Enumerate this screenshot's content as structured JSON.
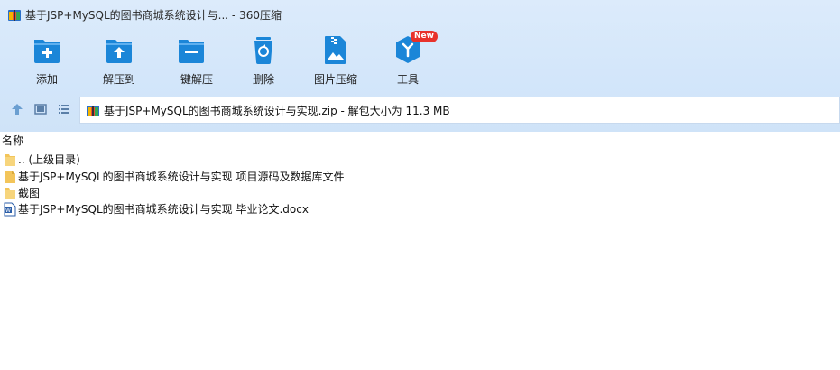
{
  "window": {
    "title": "基于JSP+MySQL的图书商城系统设计与... - 360压缩",
    "icon": "archive-icon"
  },
  "toolbar": {
    "items": [
      {
        "label": "添加",
        "icon": "add-folder-icon"
      },
      {
        "label": "解压到",
        "icon": "extract-to-icon"
      },
      {
        "label": "一键解压",
        "icon": "one-click-extract-icon"
      },
      {
        "label": "删除",
        "icon": "delete-icon"
      },
      {
        "label": "图片压缩",
        "icon": "image-compress-icon"
      },
      {
        "label": "工具",
        "icon": "tools-icon",
        "badge": "New"
      }
    ]
  },
  "address": {
    "path": "基于JSP+MySQL的图书商城系统设计与实现.zip - 解包大小为 11.3 MB"
  },
  "list": {
    "column_name": "名称",
    "items": [
      {
        "name": ".. (上级目录)",
        "icon": "folder-icon"
      },
      {
        "name": "基于JSP+MySQL的图书商城系统设计与实现 项目源码及数据库文件",
        "icon": "file-icon"
      },
      {
        "name": "截图",
        "icon": "folder-icon"
      },
      {
        "name": "基于JSP+MySQL的图书商城系统设计与实现 毕业论文.docx",
        "icon": "word-doc-icon"
      }
    ]
  },
  "colors": {
    "accent": "#1b86d8",
    "toolbar_bg": "#d6e8fb",
    "badge": "#e8322b",
    "folder": "#f3c55a"
  }
}
